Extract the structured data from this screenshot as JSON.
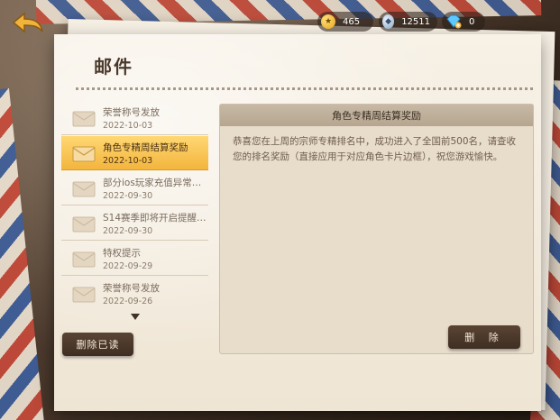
{
  "header": {
    "title": "邮件",
    "currencies": {
      "gold": "465",
      "silver": "12511",
      "diamond": "0"
    }
  },
  "mail_list": {
    "items": [
      {
        "subject": "荣誉称号发放",
        "date": "2022-10-03",
        "selected": false
      },
      {
        "subject": "角色专精周结算奖励",
        "date": "2022-10-03",
        "selected": true
      },
      {
        "subject": "部分ios玩家充值异常…",
        "date": "2022-09-30",
        "selected": false
      },
      {
        "subject": "S14赛季即将开启提醒…",
        "date": "2022-09-30",
        "selected": false
      },
      {
        "subject": "特权提示",
        "date": "2022-09-29",
        "selected": false
      },
      {
        "subject": "荣誉称号发放",
        "date": "2022-09-26",
        "selected": false
      }
    ],
    "delete_read_label": "删除已读"
  },
  "detail": {
    "title": "角色专精周结算奖励",
    "body": "恭喜您在上周的宗师专精排名中，成功进入了全国前500名，请查收您的排名奖励（直接应用于对应角色卡片边框），祝您游戏愉快。",
    "delete_label": "删 除"
  },
  "colors": {
    "selected_item": "#f3b53d",
    "button_dark": "#4a3829",
    "paper": "#f3ebdd"
  }
}
